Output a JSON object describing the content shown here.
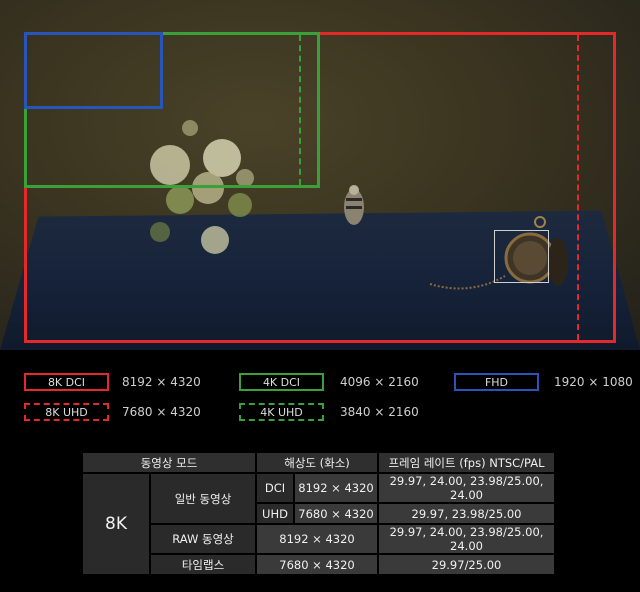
{
  "legend": [
    {
      "label": "8K DCI",
      "value": "8192 × 4320",
      "color": "#e5282a",
      "style": "solid"
    },
    {
      "label": "4K DCI",
      "value": "4096 × 2160",
      "color": "#3aa13a",
      "style": "solid"
    },
    {
      "label": "FHD",
      "value": "1920 × 1080",
      "color": "#2a55b8",
      "style": "solid"
    },
    {
      "label": "8K UHD",
      "value": "7680 × 4320",
      "color": "#e5282a",
      "style": "dashed"
    },
    {
      "label": "4K UHD",
      "value": "3840 × 2160",
      "color": "#3aa13a",
      "style": "dashed"
    }
  ],
  "table": {
    "headers": [
      "동영상 모드",
      "해상도 (화소)",
      "프레임 레이트 (fps) NTSC/PAL"
    ],
    "mode": "8K",
    "normal_video": "일반 동영상",
    "dci_label": "DCI",
    "dci_res": "8192 × 4320",
    "dci_fps": "29.97, 24.00, 23.98/25.00, 24.00",
    "uhd_label": "UHD",
    "uhd_res": "7680 × 4320",
    "uhd_fps": "29.97, 23.98/25.00",
    "raw_label": "RAW 동영상",
    "raw_res": "8192 × 4320",
    "raw_fps": "29.97, 24.00, 23.98/25.00, 24.00",
    "timelapse_label": "타임랩스",
    "timelapse_res": "7680 × 4320",
    "timelapse_fps": "29.97/25.00"
  }
}
